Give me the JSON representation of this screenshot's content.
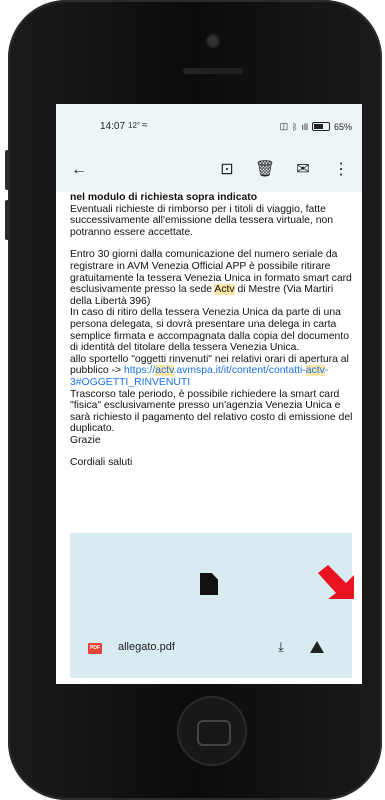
{
  "status": {
    "time": "14:07",
    "indicator": "12°",
    "battery_text": "65%"
  },
  "toolbar": {
    "back_label": "←",
    "archive_label": "⊡",
    "delete_label": "🗑",
    "mail_label": "✉",
    "more_label": "⋮"
  },
  "email": {
    "bold_line": "nel modulo di richiesta sopra indicato",
    "p1": "Eventuali richieste di rimborso per i titoli di viaggio, fatte successivamente all'emissione della tessera virtuale, non potranno essere accettate.",
    "p2_a": "Entro 30 giorni dalla comunicazione del numero seriale da registrare in AVM Venezia Official APP è possibile ritirare gratuitamente la tessera Venezia Unica in formato smart card esclusivamente presso la sede ",
    "hl1": "Actv",
    "p2_b": " di Mestre (Via Martiri della Libertà 396)",
    "p3": "In caso di ritiro della tessera Venezia Unica da parte di una persona delegata, si dovrà presentare una delega in carta semplice firmata e accompagnata dalla copia del documento di identità del titolare della tessera Venezia Unica.",
    "p4_a": "allo sportello \"oggetti rinvenuti\" nei relativi orari di apertura al pubblico -> ",
    "link_a": "https://",
    "link_hl1": "actv",
    "link_b": ".avmspa.it/it/content/contatti-",
    "link_hl2": "actv",
    "link_c": "-3#OGGETTI_RINVENUTI",
    "p5": "Trascorso tale periodo, è possibile richiedere la smart card \"fisica\" esclusivamente presso un'agenzia Venezia Unica e sarà richiesto il pagamento del relativo costo di emissione del duplicato.",
    "thanks": "Grazie",
    "closing": "Cordiali saluti"
  },
  "attachment": {
    "badge": "PDF",
    "filename": "allegato.pdf",
    "download_label": "⤓"
  }
}
